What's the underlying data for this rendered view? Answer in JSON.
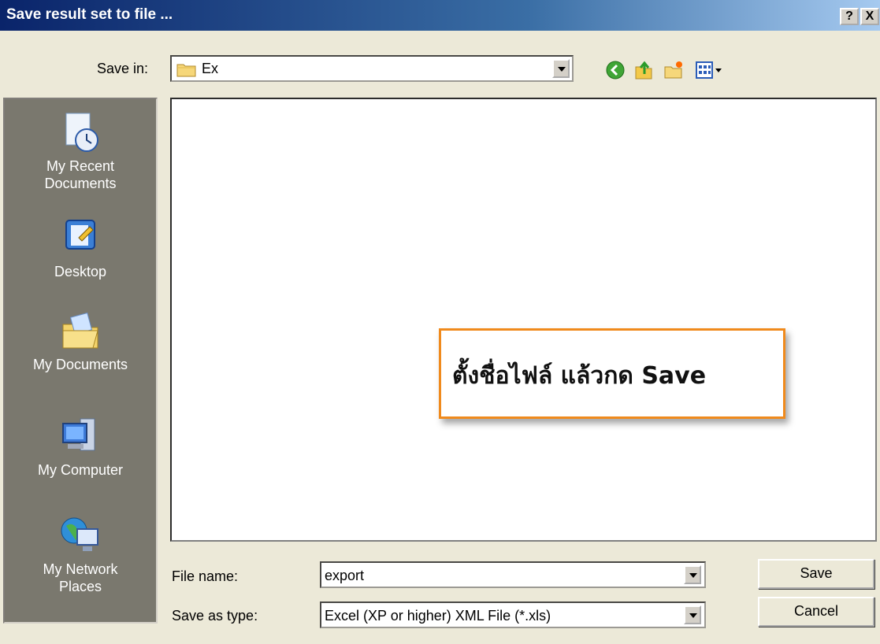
{
  "window": {
    "title": "Save result set to file ...",
    "help_button": "?",
    "close_button": "X"
  },
  "save_in": {
    "label": "Save in:",
    "value": "Ex"
  },
  "toolbar": {
    "icons": [
      "back-icon",
      "up-folder-icon",
      "new-folder-icon",
      "views-menu-icon"
    ]
  },
  "places": [
    {
      "label": "My Recent\nDocuments",
      "icon": "recent-documents-icon"
    },
    {
      "label": "Desktop",
      "icon": "desktop-icon"
    },
    {
      "label": "My Documents",
      "icon": "my-documents-icon"
    },
    {
      "label": "My Computer",
      "icon": "my-computer-icon"
    },
    {
      "label": "My Network\nPlaces",
      "icon": "network-places-icon"
    }
  ],
  "callout": {
    "text": "ตั้งชื่อไฟล์ แล้วกด Save",
    "border_color": "#f08a1c"
  },
  "file_name": {
    "label": "File name:",
    "value": "export"
  },
  "save_as_type": {
    "label": "Save as type:",
    "value": "Excel (XP or higher) XML File (*.xls)"
  },
  "buttons": {
    "save": "Save",
    "cancel": "Cancel"
  },
  "colors": {
    "titlebar_start": "#0a246a",
    "titlebar_end": "#a6caf0",
    "dialog_bg": "#ece9d8",
    "places_bg": "#7a786e"
  }
}
